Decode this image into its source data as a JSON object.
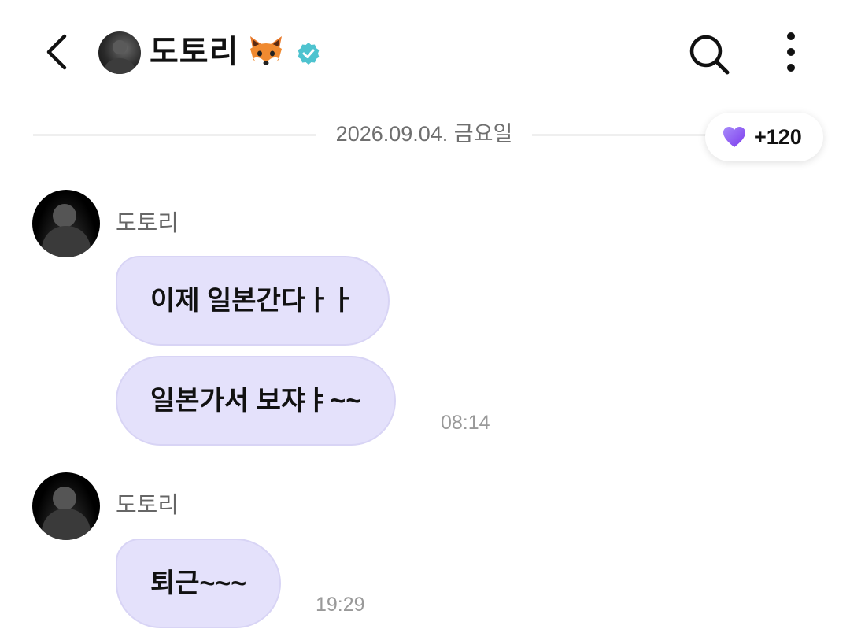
{
  "header": {
    "name": "도토리",
    "back_icon": "chevron-left-icon",
    "fox_icon": "fox-emoji-icon",
    "verified_icon": "verified-badge-icon",
    "search_icon": "search-icon",
    "more_icon": "more-vertical-icon"
  },
  "date_divider": {
    "text": "2026.09.04. 금요일"
  },
  "hearts": {
    "icon": "purple-heart-icon",
    "count": "+120",
    "color": "#8b5cf6"
  },
  "messages": [
    {
      "sender": "도토리",
      "bubbles": [
        "이제 일본간다ㅏㅏ",
        "일본가서 보쟈ㅑ~~"
      ],
      "time": "08:14"
    },
    {
      "sender": "도토리",
      "bubbles": [
        "퇴근~~~"
      ],
      "time": "19:29"
    }
  ],
  "colors": {
    "bubble_bg": "#e4e1fb",
    "verified": "#4ec3cf"
  }
}
